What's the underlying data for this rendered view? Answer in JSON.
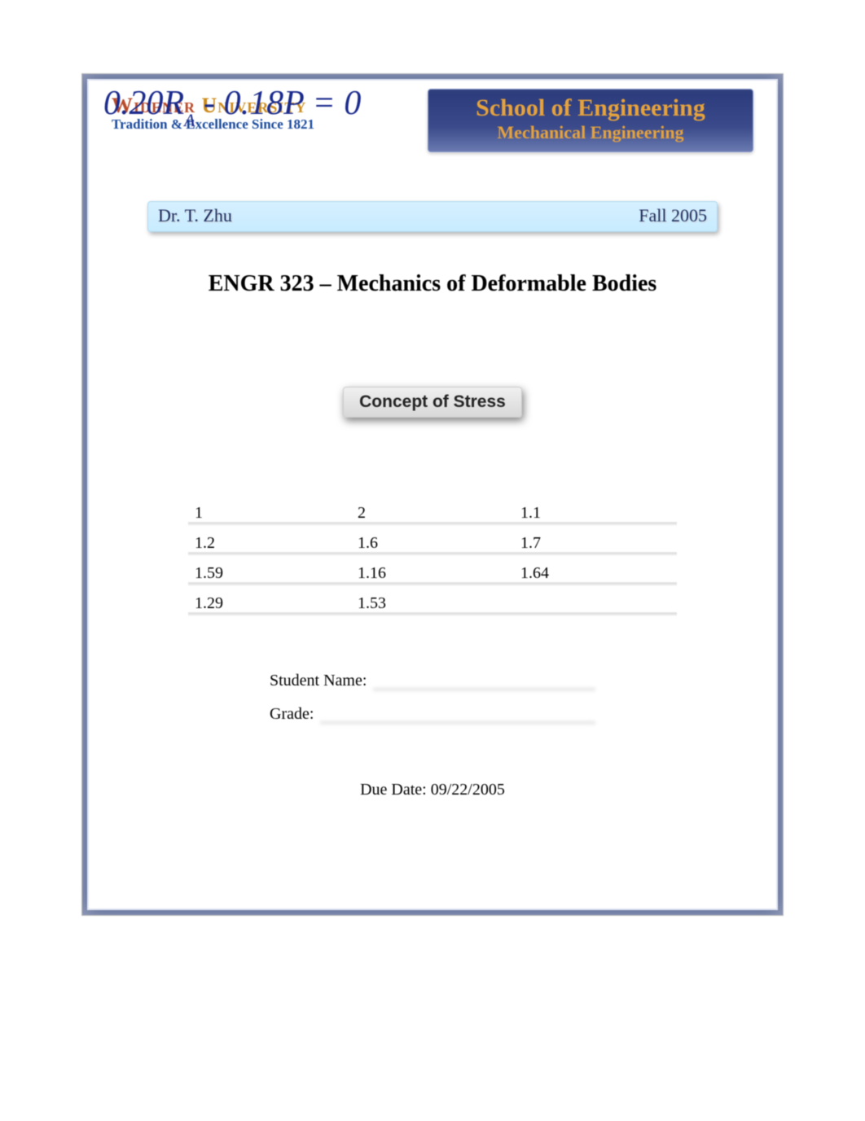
{
  "header": {
    "university_name_part1": "Widener ",
    "university_name_part2": "University",
    "tagline": "Tradition & Excellence Since 1821",
    "equation": "0.20R",
    "equation_sub": "A",
    "equation_tail": " - 0.18P = 0",
    "school_line1": "School of Engineering",
    "school_line2": "Mechanical Engineering"
  },
  "infobar": {
    "instructor": "Dr. T. Zhu",
    "term": "Fall 2005"
  },
  "course": {
    "title": "ENGR 323  – Mechanics of Deformable Bodies"
  },
  "topic": {
    "label": "Concept of Stress"
  },
  "topics_table": {
    "rows": [
      [
        "1",
        "2",
        "1.1"
      ],
      [
        "1.2",
        "1.6",
        "1.7"
      ],
      [
        "1.59",
        "1.16",
        "1.64"
      ],
      [
        "1.29",
        "1.53",
        ""
      ]
    ]
  },
  "form": {
    "name_label": "Student Name:",
    "grade_label": "Grade:"
  },
  "due": {
    "label": "Due Date:  ",
    "value": "09/22/2005"
  }
}
